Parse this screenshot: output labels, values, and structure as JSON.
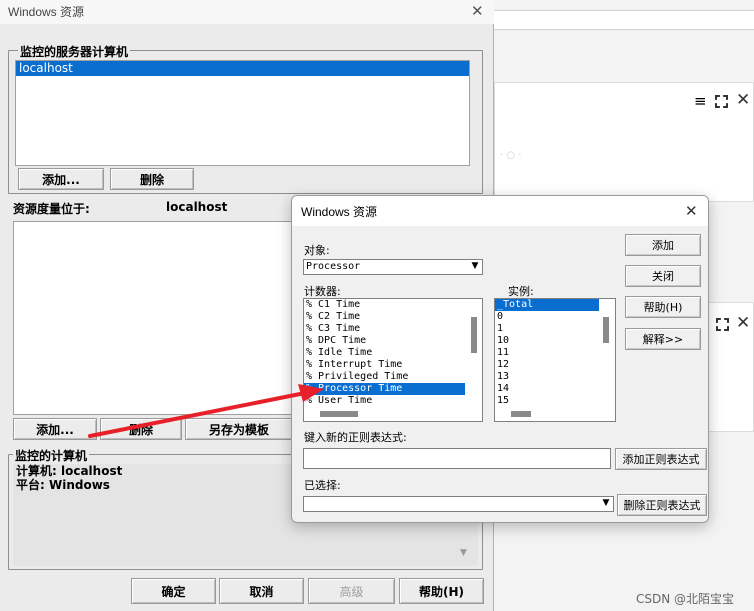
{
  "bg": {
    "window_title": "Windows 资源"
  },
  "servers": {
    "group_title": "监控的服务器计算机",
    "items": [
      "localhost"
    ],
    "add_label": "添加...",
    "delete_label": "删除"
  },
  "resource": {
    "label": "资源度量位于:",
    "value": "localhost",
    "add_label": "添加...",
    "delete_label": "删除",
    "save_template_label": "另存为模板"
  },
  "monitored": {
    "group_title": "监控的计算机",
    "machine_line": "计算机: localhost",
    "platform_line": "平台: Windows"
  },
  "footer": {
    "ok": "确定",
    "cancel": "取消",
    "advanced": "高级",
    "help": "帮助(H)"
  },
  "dialog": {
    "title": "Windows 资源",
    "object_label": "对象:",
    "object_value": "Processor",
    "counters_label": "计数器:",
    "counters": [
      "% C1 Time",
      "% C2 Time",
      "% C3 Time",
      "% DPC Time",
      "% Idle Time",
      "% Interrupt Time",
      "% Privileged Time",
      "% Processor Time",
      "% User Time"
    ],
    "instances_label": "实例:",
    "instances": [
      "_Total",
      "0",
      "1",
      "10",
      "11",
      "12",
      "13",
      "14",
      "15"
    ],
    "add_btn": "添加",
    "close_btn": "关闭",
    "help_btn": "帮助(H)",
    "explain_btn": "解释>>",
    "regex_label": "键入新的正则表达式:",
    "regex_value": "",
    "add_regex_btn": "添加正则表达式",
    "selected_label": "已选择:",
    "delete_regex_btn": "删除正则表达式"
  },
  "watermark": "CSDN @北陌宝宝"
}
